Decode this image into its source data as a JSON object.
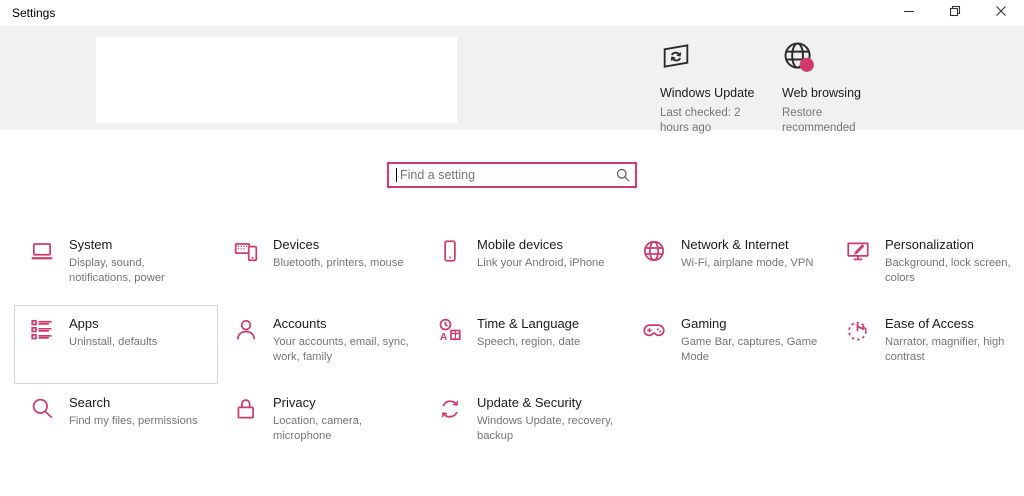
{
  "window": {
    "title": "Settings",
    "controls": [
      "minimize",
      "restore",
      "close"
    ]
  },
  "header": {
    "quick_actions": [
      {
        "icon": "windows-update-icon",
        "title": "Windows Update",
        "subtitle": "Last checked: 2 hours ago"
      },
      {
        "icon": "web-browsing-icon",
        "title": "Web browsing",
        "subtitle": "Restore recommended"
      }
    ]
  },
  "search": {
    "placeholder": "Find a setting",
    "icon": "search-icon"
  },
  "categories": [
    {
      "icon": "system-icon",
      "title": "System",
      "subtitle": "Display, sound, notifications, power"
    },
    {
      "icon": "devices-icon",
      "title": "Devices",
      "subtitle": "Bluetooth, printers, mouse"
    },
    {
      "icon": "mobile-devices-icon",
      "title": "Mobile devices",
      "subtitle": "Link your Android, iPhone"
    },
    {
      "icon": "network-internet-icon",
      "title": "Network & Internet",
      "subtitle": "Wi-Fi, airplane mode, VPN"
    },
    {
      "icon": "personalization-icon",
      "title": "Personalization",
      "subtitle": "Background, lock screen, colors"
    },
    {
      "icon": "apps-icon",
      "title": "Apps",
      "subtitle": "Uninstall, defaults",
      "highlighted": true
    },
    {
      "icon": "accounts-icon",
      "title": "Accounts",
      "subtitle": "Your accounts, email, sync, work, family"
    },
    {
      "icon": "time-language-icon",
      "title": "Time & Language",
      "subtitle": "Speech, region, date"
    },
    {
      "icon": "gaming-icon",
      "title": "Gaming",
      "subtitle": "Game Bar, captures, Game Mode"
    },
    {
      "icon": "ease-of-access-icon",
      "title": "Ease of Access",
      "subtitle": "Narrator, magnifier, high contrast"
    },
    {
      "icon": "search-category-icon",
      "title": "Search",
      "subtitle": "Find my files, permissions"
    },
    {
      "icon": "privacy-icon",
      "title": "Privacy",
      "subtitle": "Location, camera, microphone"
    },
    {
      "icon": "update-security-icon",
      "title": "Update & Security",
      "subtitle": "Windows Update, recovery, backup"
    }
  ],
  "colors": {
    "accent": "#d13a6e",
    "header_background": "#f1f1f1",
    "title_text": "#1b1b1b",
    "subtitle_text": "#767676"
  }
}
